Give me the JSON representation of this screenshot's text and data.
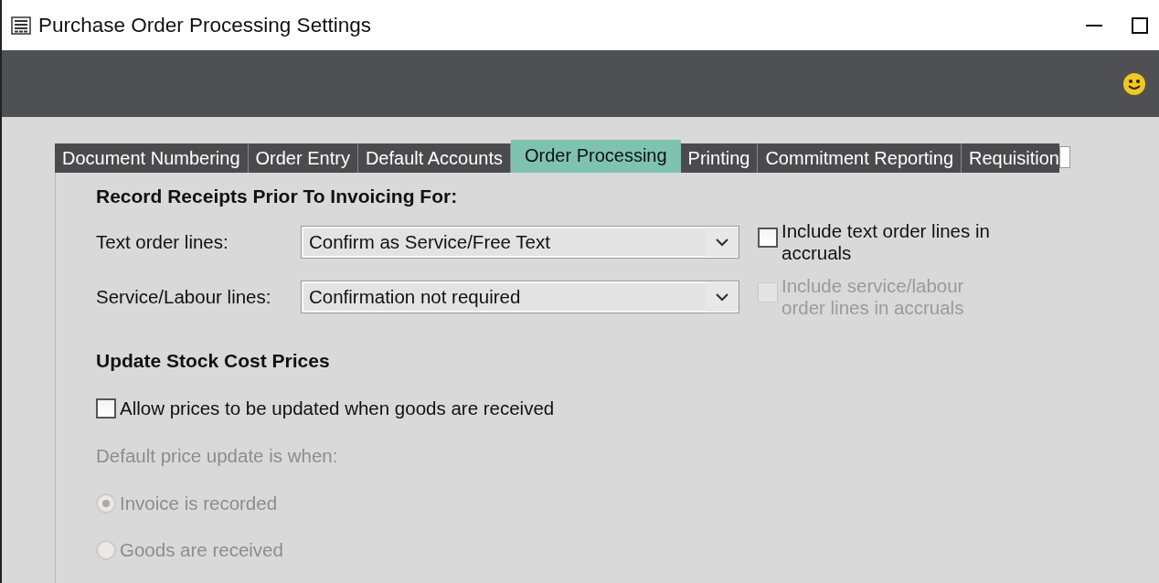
{
  "window": {
    "title": "Purchase Order Processing Settings"
  },
  "tabs": [
    {
      "label": "Document Numbering",
      "selected": false
    },
    {
      "label": "Order Entry",
      "selected": false
    },
    {
      "label": "Default Accounts",
      "selected": false
    },
    {
      "label": "Order Processing",
      "selected": true
    },
    {
      "label": "Printing",
      "selected": false
    },
    {
      "label": "Commitment Reporting",
      "selected": false
    },
    {
      "label": "Requisition",
      "selected": false
    }
  ],
  "receipts": {
    "heading": "Record Receipts Prior To Invoicing For:",
    "fields": [
      {
        "label": "Text order lines:",
        "value": "Confirm as Service/Free Text",
        "option": {
          "label": "Include text order lines in accruals",
          "checked": false,
          "disabled": false
        }
      },
      {
        "label": "Service/Labour lines:",
        "value": "Confirmation not required",
        "option": {
          "label": "Include service/labour order lines in accruals",
          "checked": false,
          "disabled": true
        }
      }
    ]
  },
  "stock": {
    "heading": "Update Stock Cost Prices",
    "allow": {
      "label": "Allow prices to be updated when goods are received",
      "checked": false
    },
    "default_label": "Default price update is when:",
    "disabled": true,
    "radios": [
      {
        "label": "Invoice is recorded",
        "selected": true
      },
      {
        "label": "Goods are received",
        "selected": false
      }
    ]
  }
}
